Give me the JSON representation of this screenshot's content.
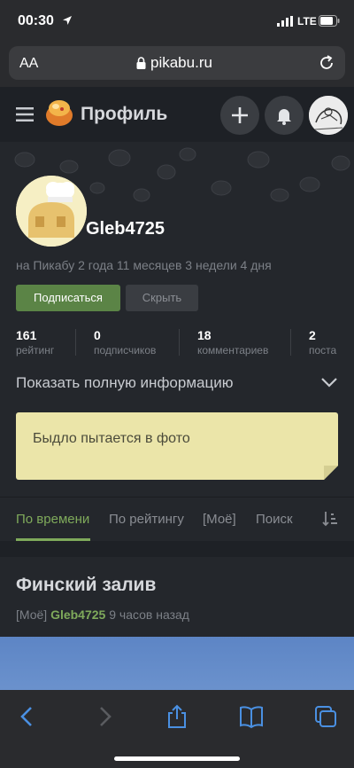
{
  "status_bar": {
    "time": "00:30",
    "network": "LTE"
  },
  "browser": {
    "text_size_label": "AA",
    "url": "pikabu.ru"
  },
  "header": {
    "title": "Профиль"
  },
  "profile": {
    "username": "Gleb4725",
    "since": "на Пикабу 2 года 11 месяцев 3 недели 4 дня",
    "subscribe_label": "Подписаться",
    "hide_label": "Скрыть",
    "stats": [
      {
        "value": "161",
        "label": "рейтинг"
      },
      {
        "value": "0",
        "label": "подписчиков"
      },
      {
        "value": "18",
        "label": "комментариев"
      },
      {
        "value": "2",
        "label": "поста"
      }
    ],
    "full_info_label": "Показать полную информацию",
    "note": "Быдло пытается в фото"
  },
  "tabs": [
    {
      "label": "По времени",
      "active": true
    },
    {
      "label": "По рейтингу",
      "active": false
    },
    {
      "label": "[Моё]",
      "active": false
    },
    {
      "label": "Поиск",
      "active": false
    }
  ],
  "story": {
    "title": "Финский залив",
    "tag": "[Моё]",
    "author": "Gleb4725",
    "time": "9 часов назад"
  },
  "colors": {
    "accent": "#7faa5b",
    "subscribe": "#5b8446",
    "note_bg": "#ebe5a9",
    "background": "#1e2126"
  },
  "icons": [
    "location-arrow-icon",
    "signal-icon",
    "battery-icon",
    "lock-icon",
    "reload-icon",
    "hamburger-icon",
    "pikabu-logo-icon",
    "plus-icon",
    "bell-icon",
    "chevron-down-icon",
    "sort-icon",
    "back-icon",
    "forward-icon",
    "share-icon",
    "bookmarks-icon",
    "tabs-icon"
  ]
}
